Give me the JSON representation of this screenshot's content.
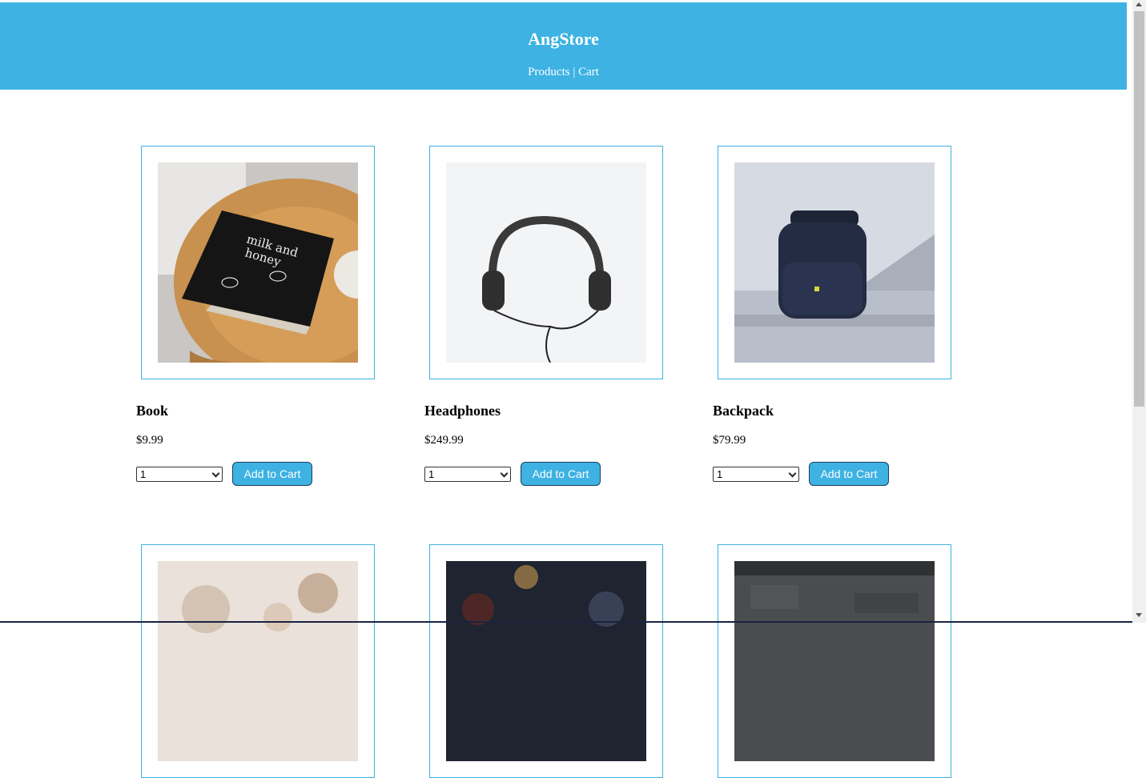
{
  "header": {
    "brand": "AngStore",
    "nav_products": "Products",
    "nav_separator": " | ",
    "nav_cart": "Cart"
  },
  "products": [
    {
      "name": "Book",
      "price": "$9.99",
      "qty": "1",
      "button": "Add to Cart",
      "image": "book-photo"
    },
    {
      "name": "Headphones",
      "price": "$249.99",
      "qty": "1",
      "button": "Add to Cart",
      "image": "headphones-photo"
    },
    {
      "name": "Backpack",
      "price": "$79.99",
      "qty": "1",
      "button": "Add to Cart",
      "image": "backpack-photo"
    }
  ],
  "more_products": [
    {
      "image": "blurred-lights-photo"
    },
    {
      "image": "blurred-dark-photo"
    },
    {
      "image": "concrete-wall-photo"
    }
  ],
  "colors": {
    "header": "#3db2e3",
    "accent_border": "#3db2e3"
  }
}
